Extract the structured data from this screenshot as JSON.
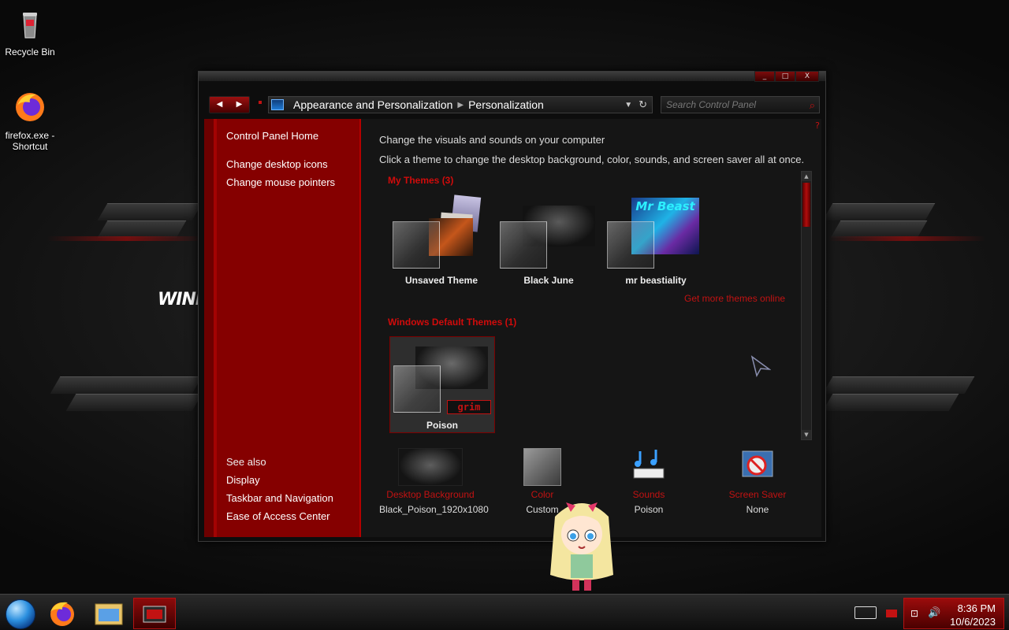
{
  "desktop": {
    "icons": [
      {
        "label": "Recycle Bin",
        "icon": "recycle-bin-icon"
      },
      {
        "label": "firefox.exe - Shortcut",
        "icon": "firefox-icon"
      }
    ],
    "wallpaper_text": "WIND"
  },
  "window": {
    "controls": {
      "minimize": "_",
      "maximize": "□",
      "close": "X"
    },
    "nav": {
      "back": "◀",
      "forward": "▶"
    },
    "breadcrumb": [
      "Appearance and Personalization",
      "Personalization"
    ],
    "search_placeholder": "Search Control Panel",
    "sidebar": {
      "links": [
        "Control Panel Home",
        "Change desktop icons",
        "Change mouse pointers"
      ],
      "see_also_heading": "See also",
      "see_also": [
        "Display",
        "Taskbar and Navigation",
        "Ease of Access Center"
      ]
    },
    "main": {
      "title": "Change the visuals and sounds on your computer",
      "description": "Click a theme to change the desktop background, color, sounds, and screen saver all at once.",
      "my_themes_heading": "My Themes (3)",
      "my_themes": [
        "Unsaved Theme",
        "Black June",
        "mr beastiality"
      ],
      "get_more_link": "Get more themes online",
      "default_themes_heading": "Windows Default Themes (1)",
      "default_themes": [
        "Poison"
      ],
      "selected_theme": "Poison",
      "thumb_texts": {
        "mrbeast": "Mr Beast",
        "grim": "grim"
      },
      "bottom": [
        {
          "title": "Desktop Background",
          "value": "Black_Poison_1920x1080"
        },
        {
          "title": "Color",
          "value": "Custom"
        },
        {
          "title": "Sounds",
          "value": "Poison"
        },
        {
          "title": "Screen Saver",
          "value": "None"
        }
      ]
    }
  },
  "taskbar": {
    "time": "8:36 PM",
    "date": "10/6/2023",
    "items": [
      "start-orb",
      "firefox",
      "file-explorer",
      "control-panel"
    ]
  },
  "colors": {
    "accent": "#c21212",
    "sidebar": "#850000",
    "panel": "#151515"
  }
}
